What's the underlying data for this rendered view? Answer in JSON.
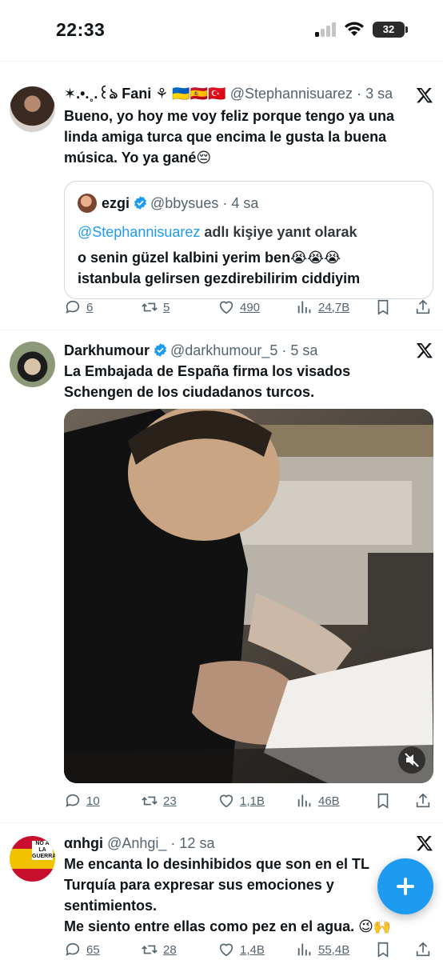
{
  "status_bar": {
    "time": "22:33",
    "battery": "32"
  },
  "tweets": [
    {
      "name": "✶.•.˳.꒰ঌ Fani ⚘ 🇺🇦🇪🇸🇹🇷",
      "handle": "@Stephannisuarez",
      "time": "· 3 sa",
      "text": "Bueno, yo hoy me voy feliz porque tengo ya una\nlinda amiga turca que encima le gusta la buena\nmúsica. Yo ya gané😔",
      "quote": {
        "name": "ezgi",
        "handle": "@bbysues",
        "time": "· 4 sa",
        "reply_mention": "@Stephannisuarez",
        "reply_suffix": " adlı kişiye yanıt olarak",
        "text": "o senin güzel kalbini yerim ben😭😭😭\nistanbula gelirsen gezdirebilirim ciddiyim"
      },
      "actions": {
        "replies": "6",
        "retweets": "5",
        "likes": "490",
        "views": "24,7B"
      }
    },
    {
      "name": "Darkhumour",
      "handle": "@darkhumour_5",
      "time": "· 5 sa",
      "text": "La Embajada de España firma los visados\nSchengen de los ciudadanos turcos.",
      "actions": {
        "replies": "10",
        "retweets": "23",
        "likes": "1,1B",
        "views": "46B"
      }
    },
    {
      "name": "αnhgi",
      "handle": "@Anhgi_",
      "time": "· 12 sa",
      "text": "Me encanta lo desinhibidos que son en el TL\nTurquía para expresar sus emociones y\nsentimientos.\nMe siento entre ellas como pez en el agua. 😉🙌",
      "avatar_badge": "NO A LA GUERRA",
      "actions": {
        "replies": "65",
        "retweets": "28",
        "likes": "1,4B",
        "views": "55,4B"
      }
    }
  ],
  "icons": {
    "reply": "reply-icon",
    "retweet": "retweet-icon",
    "like": "heart-icon",
    "views": "views-icon",
    "bookmark": "bookmark-icon",
    "share": "share-icon",
    "x_logo": "x-logo-icon",
    "verified": "verified-badge-icon",
    "compose": "compose-plus-icon"
  },
  "colors": {
    "accent": "#1d9bf0",
    "text": "#0f1419",
    "muted": "#536471",
    "border": "#cfd9de"
  }
}
